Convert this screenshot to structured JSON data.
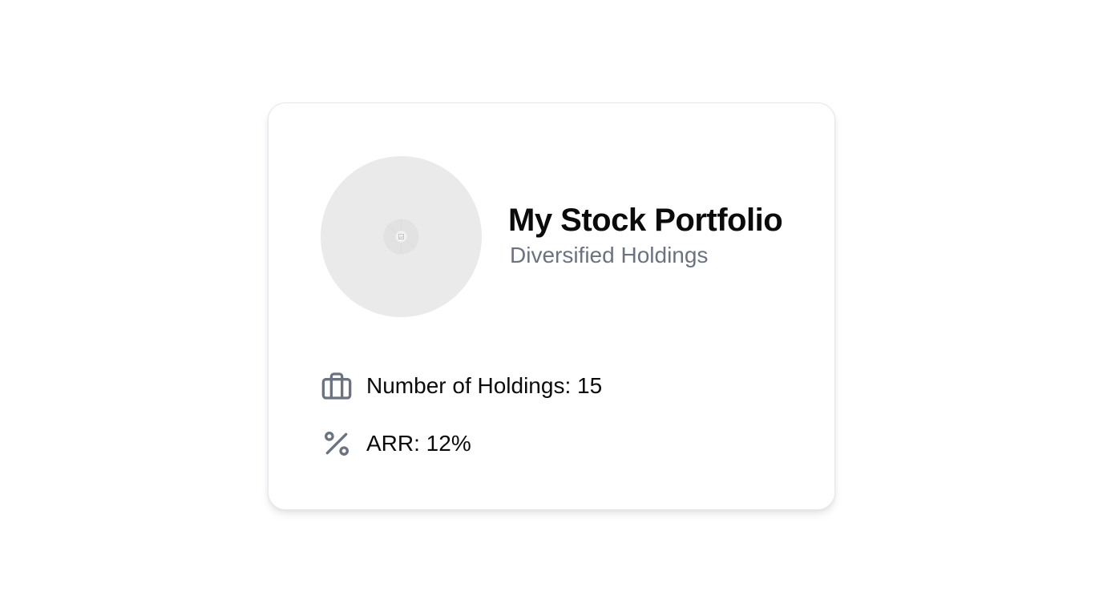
{
  "portfolio": {
    "title": "My Stock Portfolio",
    "subtitle": "Diversified Holdings"
  },
  "stats": {
    "holdings": {
      "icon": "briefcase-icon",
      "label": "Number of Holdings: 15"
    },
    "arr": {
      "icon": "percent-icon",
      "label": "ARR: 12%"
    }
  },
  "colors": {
    "avatar_placeholder": "#eaeaea",
    "subtitle": "#6b7280",
    "icon": "#6b7280",
    "text": "#0b0b0b"
  }
}
